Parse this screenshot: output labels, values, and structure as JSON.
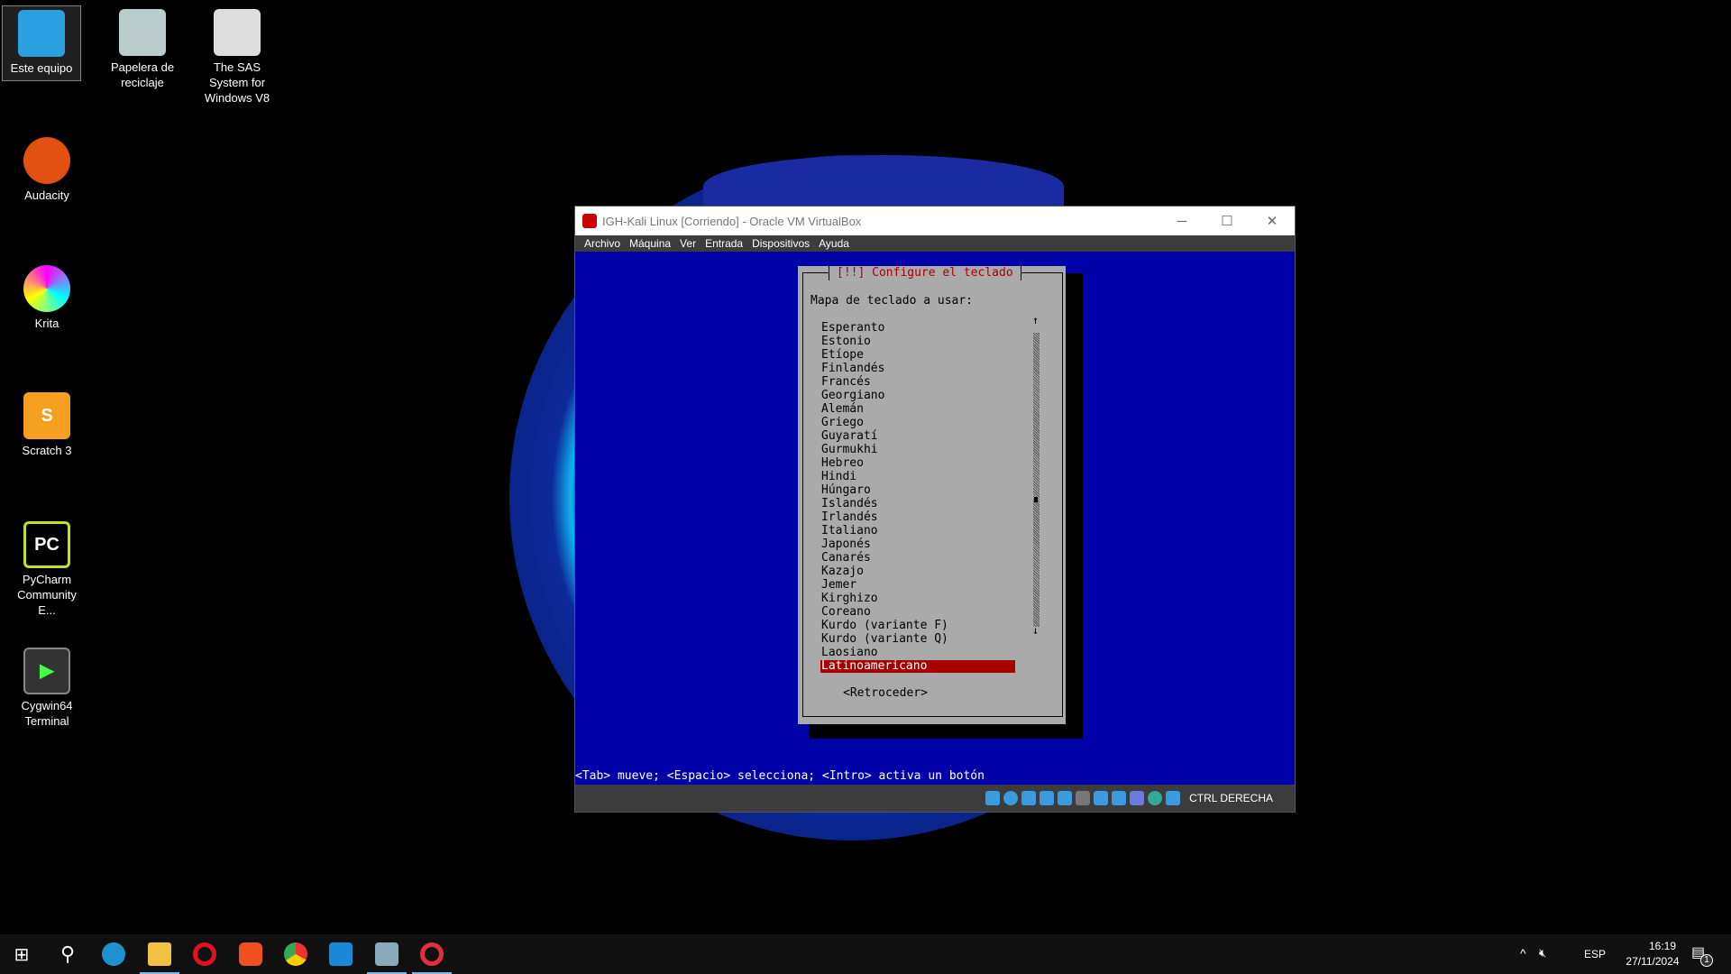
{
  "desktop": {
    "icons": [
      {
        "label": "Este equipo"
      },
      {
        "label": "Papelera de reciclaje"
      },
      {
        "label": "The SAS System for Windows V8"
      },
      {
        "label": "Audacity"
      },
      {
        "label": "Krita"
      },
      {
        "label": "Scratch 3"
      },
      {
        "label": "PyCharm Community E..."
      },
      {
        "label": "Cygwin64 Terminal"
      }
    ]
  },
  "window": {
    "title": "IGH-Kali Linux [Corriendo] - Oracle VM VirtualBox",
    "menu": [
      "Archivo",
      "Máquina",
      "Ver",
      "Entrada",
      "Dispositivos",
      "Ayuda"
    ],
    "host_key": "CTRL DERECHA"
  },
  "installer": {
    "title": "[!!] Configure el teclado",
    "prompt": "Mapa de teclado a usar:",
    "items": [
      "Esperanto",
      "Estonio",
      "Etíope",
      "Finlandés",
      "Francés",
      "Georgiano",
      "Alemán",
      "Griego",
      "Guyaratí",
      "Gurmukhi",
      "Hebreo",
      "Hindi",
      "Húngaro",
      "Islandés",
      "Irlandés",
      "Italiano",
      "Japonés",
      "Canarés",
      "Kazajo",
      "Jemer",
      "Kirghizo",
      "Coreano",
      "Kurdo (variante F)",
      "Kurdo (variante Q)",
      "Laosiano",
      "Latinoamericano"
    ],
    "selected": "Latinoamericano",
    "back_button": "<Retroceder>",
    "footer": "<Tab> mueve; <Espacio> selecciona; <Intro> activa un botón"
  },
  "taskbar": {
    "apps": [
      "start",
      "search",
      "edge",
      "file-explorer",
      "opera",
      "brave",
      "chrome",
      "vscode",
      "virtualbox",
      "kali-vm"
    ],
    "language": "ESP",
    "time": "16:19",
    "date": "27/11/2024",
    "notifications": "1"
  }
}
